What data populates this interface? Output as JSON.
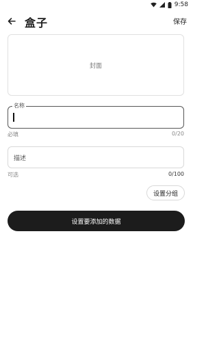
{
  "status_bar": {
    "time": "9:58",
    "icons": [
      "wifi-icon",
      "signal-icon",
      "battery-icon"
    ]
  },
  "header": {
    "back_icon": "arrow-left-icon",
    "title": "盒子",
    "save_label": "保存"
  },
  "cover": {
    "label": "封面"
  },
  "name_field": {
    "label": "名称",
    "value": "",
    "helper": "必填",
    "counter": "0/20"
  },
  "description_field": {
    "placeholder": "描述",
    "value": "",
    "helper": "可选",
    "counter": "0/100"
  },
  "group_button": {
    "label": "设置分组"
  },
  "primary_button": {
    "label": "设置要添加的数据"
  },
  "colors": {
    "primary_button_bg": "#1c1c1c",
    "border": "#e0e0e0",
    "focused_border": "#555555"
  }
}
